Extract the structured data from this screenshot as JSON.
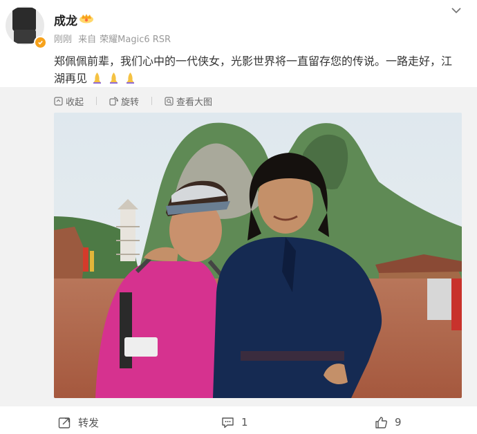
{
  "user": {
    "name": "成龙",
    "time": "刚刚",
    "source_prefix": "来自",
    "source": "荣耀Magic6 RSR"
  },
  "post": {
    "text_line1": "郑佩佩前辈，我们心中的一代侠女，光影世界将一直留存您的传说。一路走好，江",
    "text_line2": "湖再见"
  },
  "toolbar": {
    "collapse": "收起",
    "rotate": "旋转",
    "view_large": "查看大图"
  },
  "actions": {
    "repost_label": "转发",
    "comment_count": "1",
    "like_count": "9"
  },
  "colors": {
    "accent": "#f7a21b",
    "gallery_bg": "#f2f2f2",
    "prayer_emoji": "#f5c242"
  }
}
